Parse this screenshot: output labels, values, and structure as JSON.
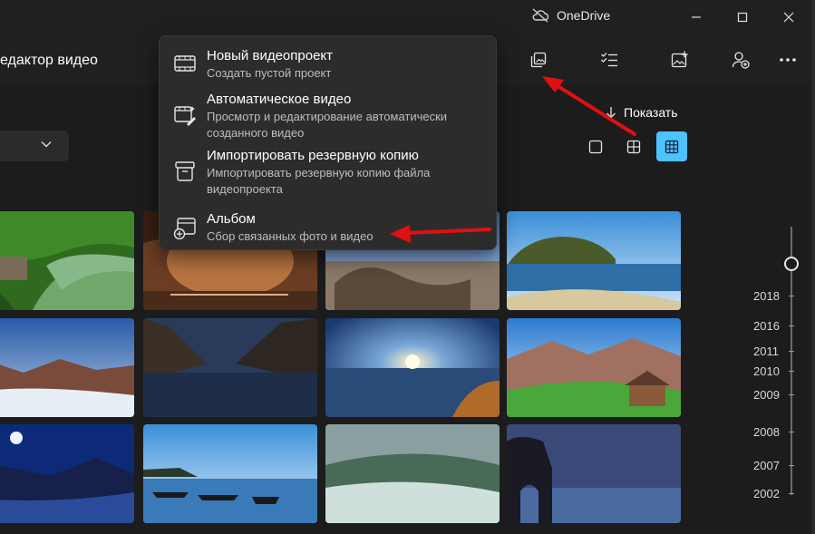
{
  "titlebar": {
    "cloud_name": "OneDrive"
  },
  "toolbar": {
    "app_title": "едактор видео"
  },
  "menu": {
    "items": [
      {
        "title": "Новый видеопроект",
        "desc": "Создать пустой проект",
        "icon": "video-project-icon"
      },
      {
        "title": "Автоматическое видео",
        "desc": "Просмотр и редактирование автоматически созданного видео",
        "icon": "auto-video-icon"
      },
      {
        "title": "Импортировать резервную копию",
        "desc": "Импортировать резервную копию файла видеопроекта",
        "icon": "archive-icon"
      },
      {
        "title": "Альбом",
        "desc": "Сбор связанных фото и видео",
        "icon": "album-icon"
      }
    ]
  },
  "view": {
    "show_label": "Показать"
  },
  "timeline": {
    "years": [
      "2018",
      "2016",
      "2011",
      "2010",
      "2009",
      "2008",
      "2007",
      "2002"
    ]
  },
  "colors": {
    "accent": "#4cc2ff",
    "arrow": "#e01010",
    "menu_bg": "#2c2c2c",
    "window_bg": "#1c1c1c"
  }
}
